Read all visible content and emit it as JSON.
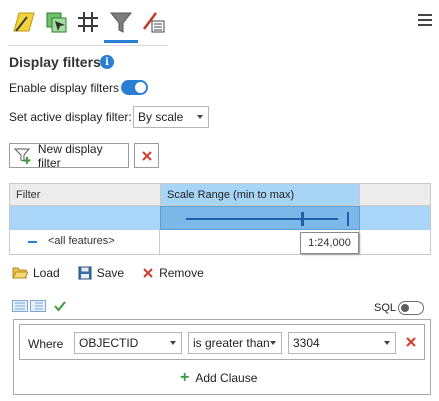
{
  "toolbar": {
    "tabs": [
      {
        "icon": "symbology-icon"
      },
      {
        "icon": "labeling-icon"
      },
      {
        "icon": "grid-icon"
      },
      {
        "icon": "filter-icon",
        "active": true
      },
      {
        "icon": "attribute-properties-icon"
      }
    ],
    "menu_icon": "hamburger-menu-icon"
  },
  "panel": {
    "title": "Display filters",
    "info_icon": "i",
    "enable_label": "Enable display filters",
    "enable_on": true,
    "active_filter_label": "Set active display filter:",
    "active_filter_value": "By scale"
  },
  "buttons": {
    "new_filter": "New display filter"
  },
  "grid": {
    "col_filter": "Filter",
    "col_scale": "Scale Range (min to max)",
    "row_all": "<all features>",
    "tooltip": "1:24,000"
  },
  "actions": {
    "load": "Load",
    "save": "Save",
    "remove": "Remove"
  },
  "sql": {
    "label": "SQL",
    "on": false
  },
  "clause": {
    "where": "Where",
    "field": "OBJECTID",
    "operator": "is greater than",
    "value": "3304",
    "add_clause": "Add Clause"
  },
  "colors": {
    "accent": "#2a7fd4",
    "header_selected": "#a8d4f5",
    "row_selected": "#a9d6f8",
    "delete_red": "#d23f31",
    "add_green": "#3a9b3a"
  }
}
